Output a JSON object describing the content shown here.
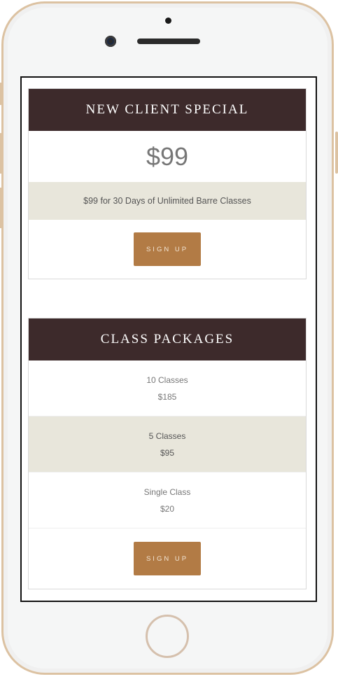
{
  "special": {
    "title": "NEW CLIENT SPECIAL",
    "price": "$99",
    "description": "$99 for 30 Days of Unlimited Barre Classes",
    "signup_label": "SIGN UP"
  },
  "packages": {
    "title": "CLASS PACKAGES",
    "items": [
      {
        "name": "10 Classes",
        "price": "$185"
      },
      {
        "name": "5 Classes",
        "price": "$95"
      },
      {
        "name": "Single Class",
        "price": "$20"
      }
    ],
    "signup_label": "SIGN UP"
  },
  "colors": {
    "header_bg": "#3d2a2b",
    "band_bg": "#e8e6db",
    "button_bg": "#b27b45",
    "phone_frame": "#dcc2a2"
  }
}
